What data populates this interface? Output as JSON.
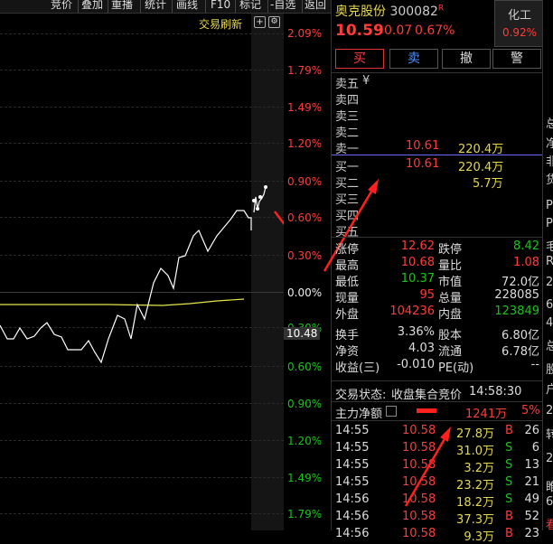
{
  "toolbar": {
    "items": [
      "竞价",
      "叠加",
      "重播",
      "统计",
      "画线",
      "F10",
      "标记",
      "-自选",
      "返回"
    ]
  },
  "chart": {
    "refresh_label": "交易刷新",
    "pct_labels_up": [
      "2.09%",
      "1.79%",
      "1.49%",
      "1.20%",
      "0.90%",
      "0.60%",
      "0.30%"
    ],
    "zero_label": "0.00%",
    "pct_labels_down": [
      "0.30%",
      "0.60%",
      "0.90%",
      "1.20%",
      "1.49%",
      "1.79%"
    ],
    "price_label": "10.48",
    "icons": [
      "plus-icon",
      "settings-icon"
    ]
  },
  "stock": {
    "name": "奥克股份",
    "code": "300082",
    "flag": "R",
    "price": "10.59",
    "change": "0.07",
    "change_pct": "0.67%",
    "sector_name": "化工",
    "sector_pct": "0.92%"
  },
  "trade_buttons": [
    "买",
    "卖",
    "撤",
    "警"
  ],
  "order_book": {
    "sell": [
      {
        "label": "卖五",
        "price": "¥",
        "vol": ""
      },
      {
        "label": "卖四",
        "price": "",
        "vol": ""
      },
      {
        "label": "卖三",
        "price": "",
        "vol": ""
      },
      {
        "label": "卖二",
        "price": "",
        "vol": ""
      },
      {
        "label": "卖一",
        "price": "10.61",
        "vol": "220.4万"
      }
    ],
    "buy": [
      {
        "label": "买一",
        "price": "10.61",
        "vol": "220.4万"
      },
      {
        "label": "买二",
        "price": "",
        "vol": "5.7万"
      },
      {
        "label": "买三",
        "price": "",
        "vol": ""
      },
      {
        "label": "买四",
        "price": "",
        "vol": ""
      },
      {
        "label": "买五",
        "price": "",
        "vol": ""
      }
    ]
  },
  "stats": [
    {
      "l1": "涨停",
      "v1": "12.62",
      "l2": "跌停",
      "v2": "8.42"
    },
    {
      "l1": "最高",
      "v1": "10.68",
      "l2": "量比",
      "v2": "1.08"
    },
    {
      "l1": "最低",
      "v1": "10.37",
      "l2": "市值",
      "v2": "72.0亿"
    },
    {
      "l1": "现量",
      "v1": "95",
      "l2": "总量",
      "v2": "228085"
    },
    {
      "l1": "外盘",
      "v1": "104236",
      "l2": "内盘",
      "v2": "123849"
    },
    {
      "l1": "换手",
      "v1": "3.36%",
      "l2": "股本",
      "v2": "6.80亿"
    },
    {
      "l1": "净资",
      "v1": "4.03",
      "l2": "流通",
      "v2": "6.78亿"
    },
    {
      "l1": "收益(三)",
      "v1": "-0.010",
      "l2": "PE(动)",
      "v2": "--"
    }
  ],
  "status": {
    "label": "交易状态:",
    "value": "收盘集合竞价",
    "time": "14:58:30"
  },
  "main_flow": {
    "label": "主力净额",
    "value": "1241万",
    "pct": "5%"
  },
  "ticks": [
    {
      "time": "14:55",
      "price": "10.58",
      "vol": "27.8万",
      "side": "B",
      "count": "26"
    },
    {
      "time": "14:55",
      "price": "10.58",
      "vol": "31.0万",
      "side": "S",
      "count": "6"
    },
    {
      "time": "14:55",
      "price": "10.58",
      "vol": "3.2万",
      "side": "S",
      "count": "13"
    },
    {
      "time": "14:55",
      "price": "10.58",
      "vol": "23.2万",
      "side": "S",
      "count": "21"
    },
    {
      "time": "14:56",
      "price": "10.58",
      "vol": "18.2万",
      "side": "S",
      "count": "49"
    },
    {
      "time": "14:56",
      "price": "10.58",
      "vol": "37.3万",
      "side": "B",
      "count": "52"
    },
    {
      "time": "14:56",
      "price": "10.58",
      "vol": "9.3万",
      "side": "B",
      "count": "23"
    }
  ],
  "edge_chars": [
    "总",
    "净",
    "非",
    "货",
    "P",
    "P",
    "毛",
    "R",
    "2",
    "6",
    "4",
    "总",
    "股",
    "户",
    "2",
    "转",
    "2",
    "睢",
    "6",
    "看"
  ]
}
